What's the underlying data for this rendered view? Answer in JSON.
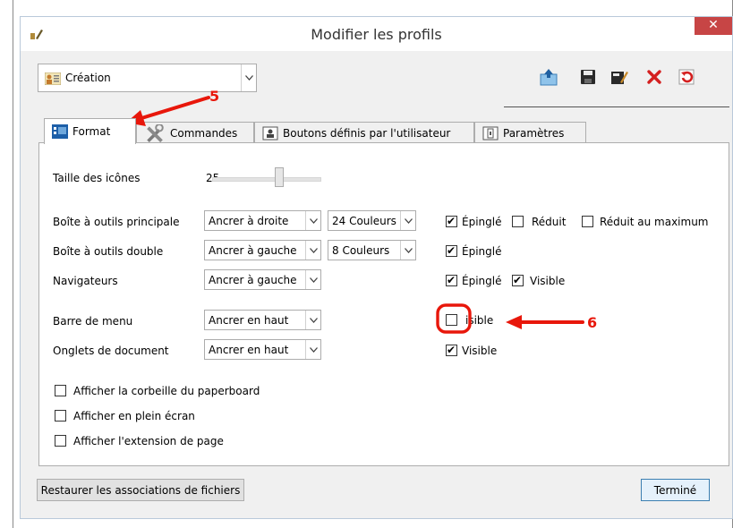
{
  "window": {
    "title": "Modifier les profils",
    "close_glyph": "✕"
  },
  "profile": {
    "selected": "Création"
  },
  "toolbar": {
    "icons": [
      "export-icon",
      "save-icon",
      "edit-icon",
      "delete-icon",
      "refresh-icon"
    ]
  },
  "tabs": [
    {
      "label": "Format",
      "icon": "format-icon"
    },
    {
      "label": "Commandes",
      "icon": "tools-icon"
    },
    {
      "label": "Boutons définis par l'utilisateur",
      "icon": "user-button-icon"
    },
    {
      "label": "Paramètres",
      "icon": "settings-icon"
    }
  ],
  "format": {
    "icon_size_label": "Taille des icônes",
    "icon_size_value": "25",
    "rows": [
      {
        "label": "Boîte à outils principale",
        "dock": "Ancrer à droite",
        "colors": "24 Couleurs",
        "checks": [
          {
            "label": "Épinglé",
            "checked": true
          },
          {
            "label": "Réduit",
            "checked": false
          },
          {
            "label": "Réduit au maximum",
            "checked": false
          }
        ]
      },
      {
        "label": "Boîte à outils double",
        "dock": "Ancrer à gauche",
        "colors": "8 Couleurs",
        "checks": [
          {
            "label": "Épinglé",
            "checked": true
          }
        ]
      },
      {
        "label": "Navigateurs",
        "dock": "Ancrer à gauche",
        "checks": [
          {
            "label": "Épinglé",
            "checked": true
          },
          {
            "label": "Visible",
            "checked": true
          }
        ]
      },
      {
        "label": "Barre de menu",
        "dock": "Ancrer en haut",
        "checks": [
          {
            "label": "isible",
            "checked": false
          }
        ]
      },
      {
        "label": "Onglets de document",
        "dock": "Ancrer en haut",
        "checks": [
          {
            "label": "Visible",
            "checked": true
          }
        ]
      }
    ],
    "options": [
      {
        "label": "Afficher la corbeille du paperboard",
        "checked": false
      },
      {
        "label": "Afficher en plein écran",
        "checked": false
      },
      {
        "label": "Afficher l'extension de page",
        "checked": false
      }
    ]
  },
  "footer": {
    "restore_label": "Restaurer les associations de fichiers",
    "done_label": "Terminé"
  },
  "annotations": {
    "step5": "5",
    "step6": "6",
    "color": "#e8170b"
  }
}
